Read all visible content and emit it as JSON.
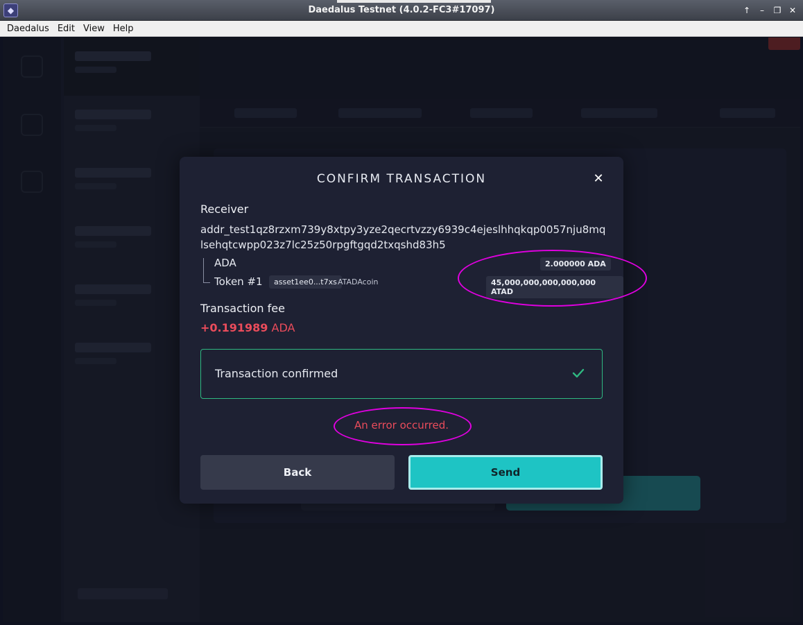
{
  "window": {
    "title": "Daedalus Testnet (4.0.2-FC3#17097)",
    "controls": [
      "↑",
      "–",
      "❐",
      "✕"
    ]
  },
  "menubar": {
    "items": [
      "Daedalus",
      "Edit",
      "View",
      "Help"
    ]
  },
  "dialog": {
    "title": "CONFIRM TRANSACTION",
    "close": "✕",
    "receiver_label": "Receiver",
    "receiver_address": "addr_test1qz8rzxm739y8xtpy3yze2qecrtvzzy6939c4ejeslhhqkqp0057nju8mqlsehqtcwpp023z7lc25z50rpgftgqd2txqshd83h5",
    "assets": [
      {
        "label": "ADA",
        "amount": "2.000000 ADA"
      },
      {
        "label": "Token #1",
        "asset_id": "asset1ee0...t7xs",
        "ticker": "ATADAcoin",
        "amount": "45,000,000,000,000,000 ATAD"
      }
    ],
    "fee_label": "Transaction fee",
    "fee_value": "+0.191989",
    "fee_unit": "ADA",
    "status_text": "Transaction confirmed",
    "error_text": "An error occurred.",
    "back_label": "Back",
    "send_label": "Send"
  },
  "colors": {
    "accent": "#1ec4c4",
    "error": "#ea4c5b",
    "success": "#2fb982",
    "annotation": "#e000e0"
  }
}
